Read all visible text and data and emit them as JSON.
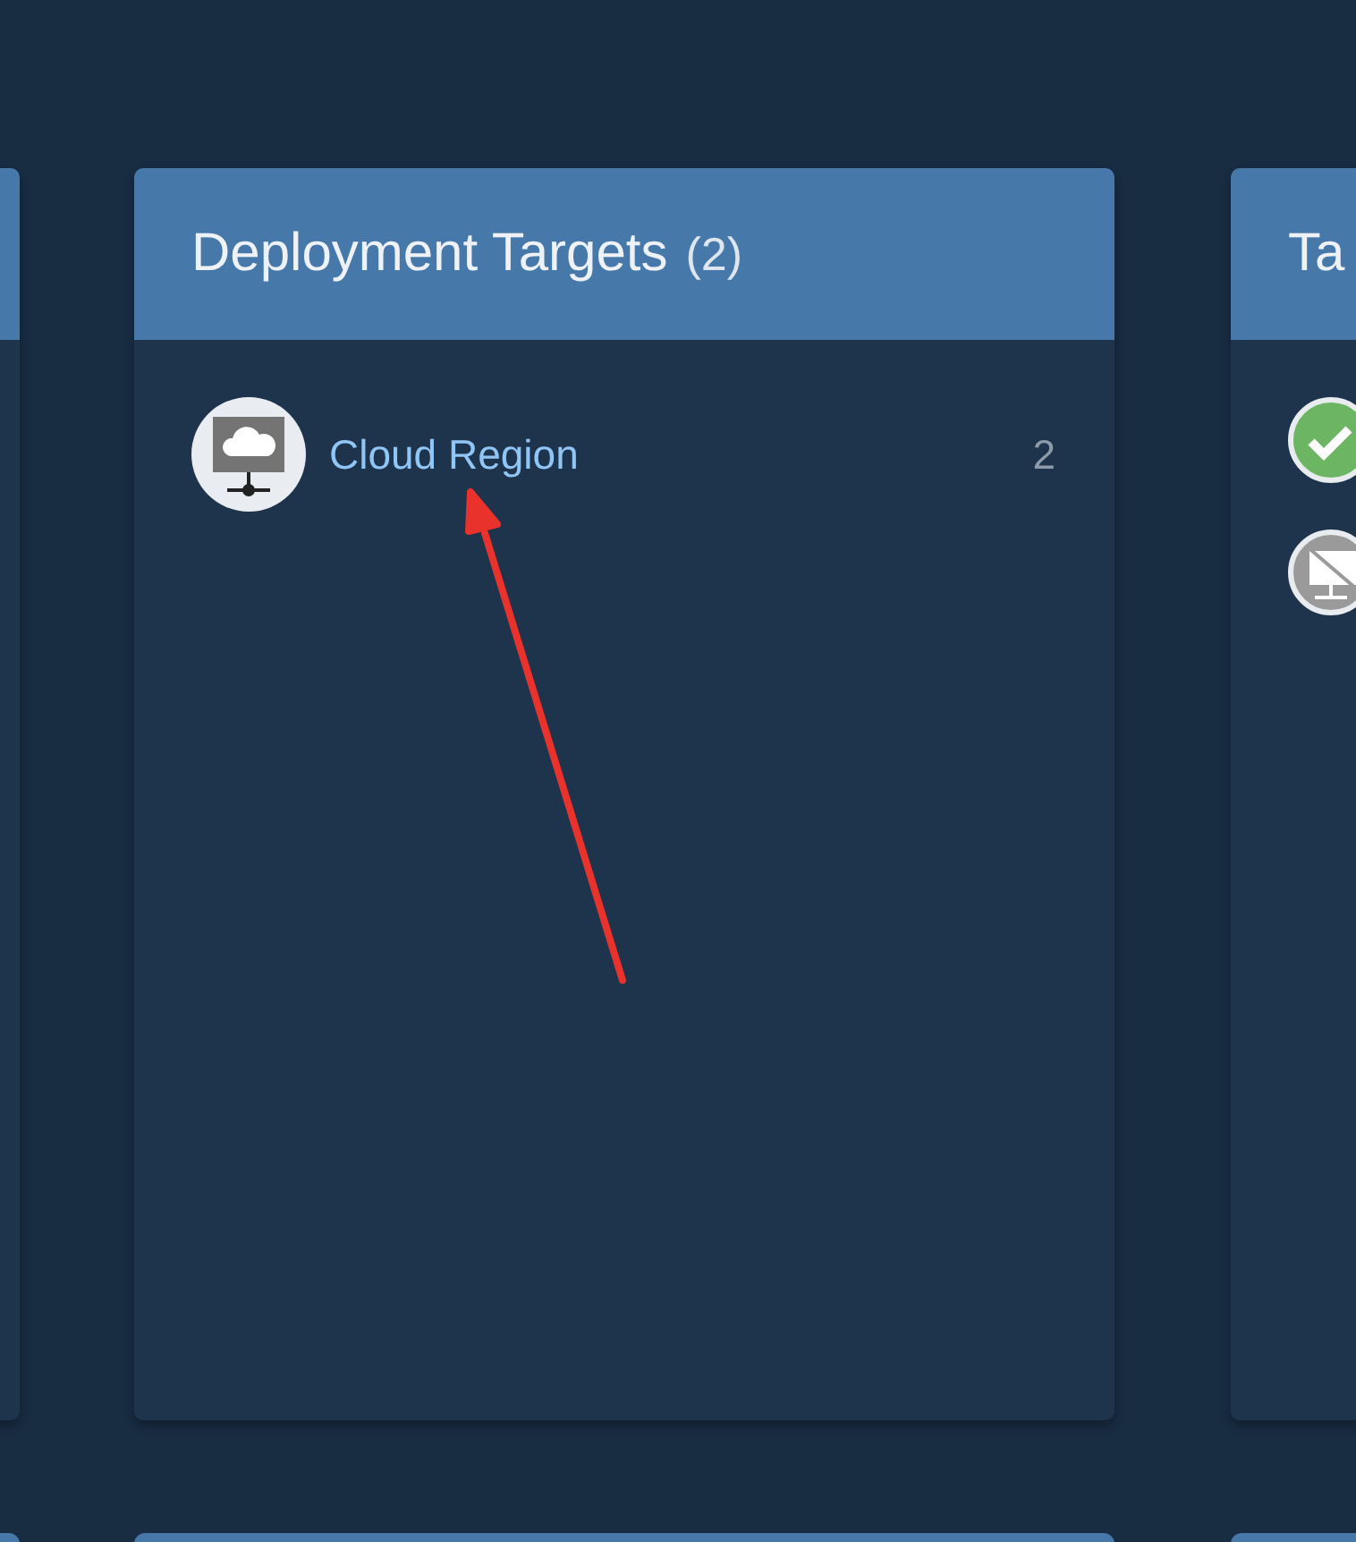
{
  "cards": [
    {
      "kind": "blank"
    },
    {
      "kind": "list",
      "title": "Deployment Targets",
      "count": "(2)",
      "items": [
        {
          "kind": "cloud",
          "name": "Cloud Region",
          "count": "2"
        }
      ]
    },
    {
      "kind": "status",
      "title": "Ta",
      "items": [
        {
          "kind": "check"
        },
        {
          "kind": "disabled"
        }
      ]
    }
  ],
  "annotation": {
    "kind": "arrow"
  }
}
